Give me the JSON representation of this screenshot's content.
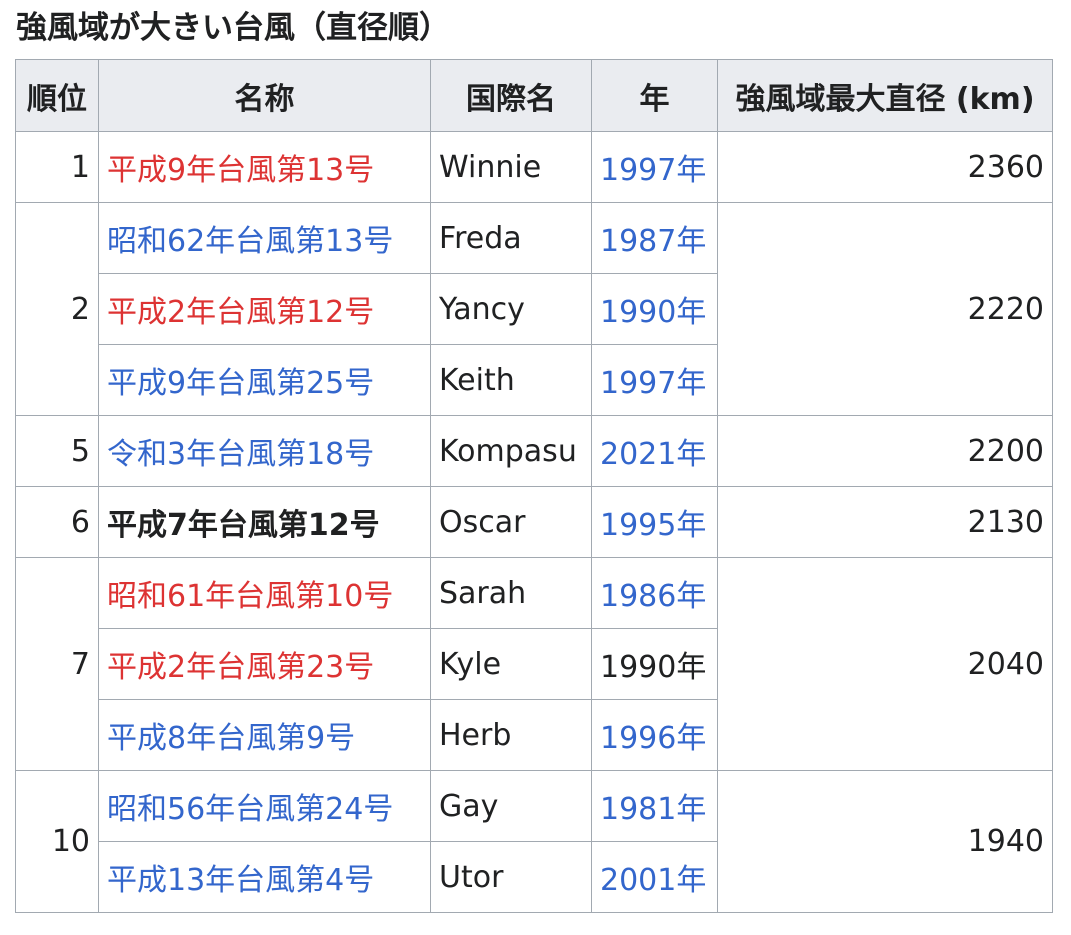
{
  "caption": "強風域が大きい台風（直径順）",
  "headers": {
    "rank": "順位",
    "name": "名称",
    "intl_name": "国際名",
    "year": "年",
    "diameter": "強風域最大直径 (km)"
  },
  "colors": {
    "link": "#3366cc",
    "redlink": "#dd3333",
    "text": "#202122",
    "header_bg": "#eaecf0",
    "border": "#a2a9b1"
  },
  "groups": [
    {
      "rank": "1",
      "diameter": "2360",
      "rows": [
        {
          "name": "平成9年台風第13号",
          "name_style": "red",
          "intl": "Winnie",
          "year": "1997年",
          "year_style": "blue"
        }
      ]
    },
    {
      "rank": "2",
      "diameter": "2220",
      "rows": [
        {
          "name": "昭和62年台風第13号",
          "name_style": "blue",
          "intl": "Freda",
          "year": "1987年",
          "year_style": "blue"
        },
        {
          "name": "平成2年台風第12号",
          "name_style": "red",
          "intl": "Yancy",
          "year": "1990年",
          "year_style": "blue"
        },
        {
          "name": "平成9年台風第25号",
          "name_style": "blue",
          "intl": "Keith",
          "year": "1997年",
          "year_style": "blue"
        }
      ]
    },
    {
      "rank": "5",
      "diameter": "2200",
      "rows": [
        {
          "name": "令和3年台風第18号",
          "name_style": "blue",
          "intl": "Kompasu",
          "year": "2021年",
          "year_style": "blue"
        }
      ]
    },
    {
      "rank": "6",
      "diameter": "2130",
      "rows": [
        {
          "name": "平成7年台風第12号",
          "name_style": "bold",
          "intl": "Oscar",
          "year": "1995年",
          "year_style": "blue"
        }
      ]
    },
    {
      "rank": "7",
      "diameter": "2040",
      "rows": [
        {
          "name": "昭和61年台風第10号",
          "name_style": "red",
          "intl": "Sarah",
          "year": "1986年",
          "year_style": "blue"
        },
        {
          "name": "平成2年台風第23号",
          "name_style": "red",
          "intl": "Kyle",
          "year": "1990年",
          "year_style": "plain"
        },
        {
          "name": "平成8年台風第9号",
          "name_style": "blue",
          "intl": "Herb",
          "year": "1996年",
          "year_style": "blue"
        }
      ]
    },
    {
      "rank": "10",
      "diameter": "1940",
      "rows": [
        {
          "name": "昭和56年台風第24号",
          "name_style": "blue",
          "intl": "Gay",
          "year": "1981年",
          "year_style": "blue"
        },
        {
          "name": "平成13年台風第4号",
          "name_style": "blue",
          "intl": "Utor",
          "year": "2001年",
          "year_style": "blue"
        }
      ]
    }
  ]
}
